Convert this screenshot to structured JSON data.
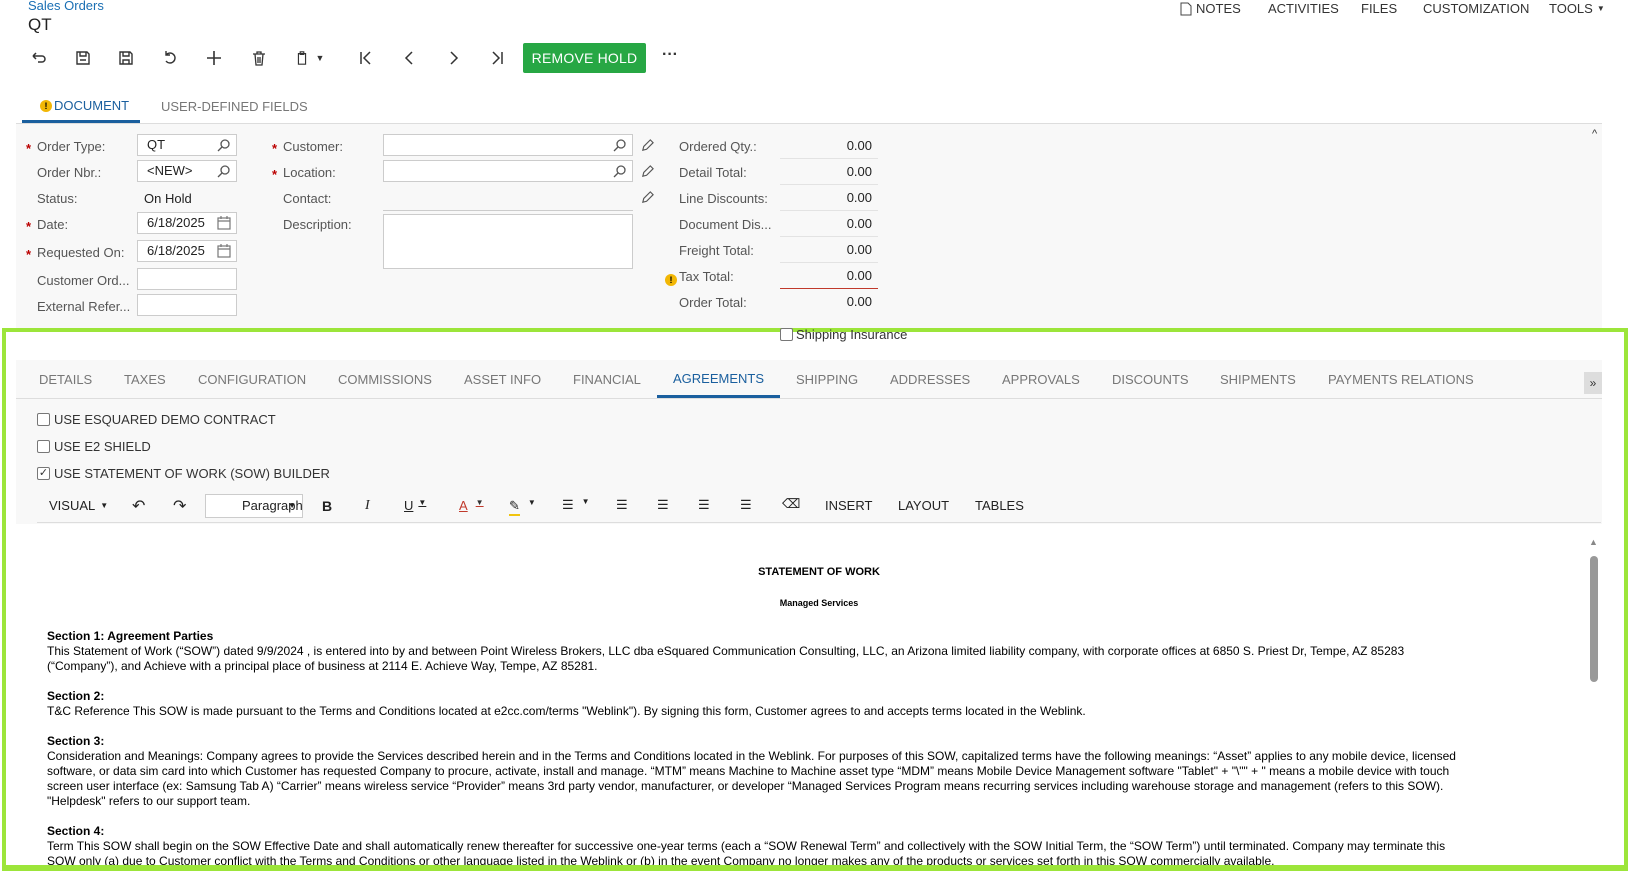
{
  "breadcrumb": "Sales Orders",
  "title": "QT",
  "topnav": {
    "notes": "NOTES",
    "activities": "ACTIVITIES",
    "files": "FILES",
    "customization": "CUSTOMIZATION",
    "tools": "TOOLS"
  },
  "toolbar": {
    "remove_hold": "REMOVE HOLD",
    "more": "···"
  },
  "tabs": {
    "document": "DOCUMENT",
    "user_defined": "USER-DEFINED FIELDS"
  },
  "form": {
    "order_type_label": "Order Type:",
    "order_type": "QT",
    "order_nbr_label": "Order Nbr.:",
    "order_nbr": "<NEW>",
    "status_label": "Status:",
    "status": "On Hold",
    "date_label": "Date:",
    "date": "6/18/2025",
    "requested_label": "Requested On:",
    "requested": "6/18/2025",
    "customer_ord_label": "Customer Ord...",
    "external_ref_label": "External Refer...",
    "customer_label": "Customer:",
    "location_label": "Location:",
    "contact_label": "Contact:",
    "description_label": "Description:"
  },
  "totals": {
    "ordered_qty_label": "Ordered Qty.:",
    "ordered_qty": "0.00",
    "detail_total_label": "Detail Total:",
    "detail_total": "0.00",
    "line_discounts_label": "Line Discounts:",
    "line_discounts": "0.00",
    "document_dis_label": "Document Dis...",
    "document_dis": "0.00",
    "freight_total_label": "Freight Total:",
    "freight_total": "0.00",
    "tax_total_label": "Tax Total:",
    "tax_total": "0.00",
    "order_total_label": "Order Total:",
    "order_total": "0.00",
    "shipping_insurance": "Shipping Insurance"
  },
  "bottom_tabs": [
    "DETAILS",
    "TAXES",
    "CONFIGURATION",
    "COMMISSIONS",
    "ASSET INFO",
    "FINANCIAL",
    "AGREEMENTS",
    "SHIPPING",
    "ADDRESSES",
    "APPROVALS",
    "DISCOUNTS",
    "SHIPMENTS",
    "PAYMENTS",
    "RELATIONS"
  ],
  "agreements": {
    "opt1": "USE ESQUARED DEMO CONTRACT",
    "opt2": "USE E2 SHIELD",
    "opt3": "USE STATEMENT OF WORK (SOW) BUILDER"
  },
  "editor_toolbar": {
    "visual": "VISUAL",
    "paragraph": "Paragraph",
    "insert": "INSERT",
    "layout": "LAYOUT",
    "tables": "TABLES"
  },
  "doc": {
    "title": "STATEMENT OF WORK",
    "subtitle": "Managed Services",
    "s1_head": "Section 1: Agreement Parties",
    "s1_l1": "This Statement of Work (“SOW”) dated 9/9/2024 , is entered into by and between Point Wireless Brokers, LLC dba eSquared Communication Consulting, LLC, an Arizona limited liability company, with corporate offices at 6850 S. Priest Dr, Tempe, AZ 85283",
    "s1_l2": "(“Company”), and Achieve with a principal place of business at 2114 E. Achieve Way, Tempe, AZ 85281.",
    "s2_head": "Section 2:",
    "s2_l1": "T&C Reference This SOW is made pursuant to the Terms and Conditions located at e2cc.com/terms \"Weblink\"). By signing this form, Customer agrees to and accepts terms located in the Weblink.",
    "s3_head": "Section 3:",
    "s3_l1": "Consideration and Meanings: Company agrees to provide the Services described herein and in the Terms and Conditions located in the Weblink. For purposes of this SOW, capitalized terms have the following meanings: “Asset” applies to any mobile device, licensed",
    "s3_l2": "software, or data sim card into which Customer has requested Company to procure, activate, install and manage. “MTM” means Machine to Machine asset type “MDM” means Mobile Device Management software \"Tablet\" + \"\\\"\" + \" means a mobile device with touch",
    "s3_l3": "screen user interface (ex: Samsung Tab A) “Carrier” means wireless service “Provider” means 3rd party vendor, manufacturer, or developer “Managed Services Program means recurring services including warehouse storage and management (refers to this SOW).",
    "s3_l4": "\"Helpdesk\" refers to our support team.",
    "s4_head": "Section 4:",
    "s4_l1": "Term This SOW shall begin on the SOW Effective Date and shall automatically renew thereafter for successive one-year terms (each a “SOW Renewal Term” and collectively with the SOW Initial Term, the “SOW Term”) until terminated. Company may terminate this",
    "s4_l2": "SOW only (a) due to Customer conflict with the Terms and Conditions or other language listed in the Weblink or (b) in the event Company no longer makes any of the products or services set forth in this SOW commercially available."
  }
}
